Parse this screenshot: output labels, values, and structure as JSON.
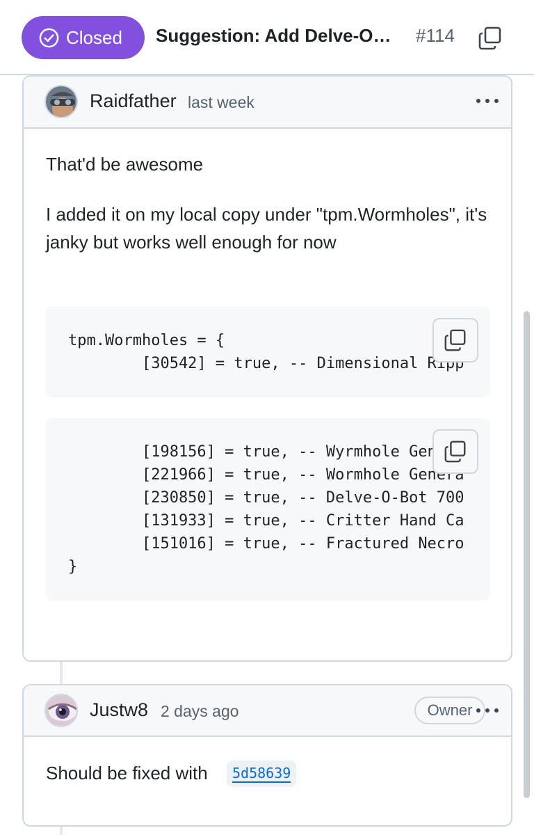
{
  "header": {
    "state_label": "Closed",
    "title": "Suggestion: Add Delve-O…",
    "number": "#114"
  },
  "comments": [
    {
      "author": "Raidfather",
      "time": "last week",
      "paragraphs": [
        "That'd be awesome",
        "I added it on my local copy under \"tpm.Wormholes\", it's janky but works well enough for now"
      ],
      "code_blocks": [
        "tpm.Wormholes = {\n        [30542] = true, -- Dimensional Ripp",
        "        [198156] = true, -- Wyrmhole Genera\n        [221966] = true, -- Wormhole Genera\n        [230850] = true, -- Delve-O-Bot 700\n        [131933] = true, -- Critter Hand Ca\n        [151016] = true, -- Fractured Necro\n}"
      ]
    },
    {
      "author": "Justw8",
      "time": "2 days ago",
      "badge": "Owner",
      "text": "Should be fixed with",
      "commit": "5d58639"
    }
  ],
  "colors": {
    "closed_purple": "#8250df",
    "link_blue": "#0969da",
    "border": "#d0d7de"
  }
}
